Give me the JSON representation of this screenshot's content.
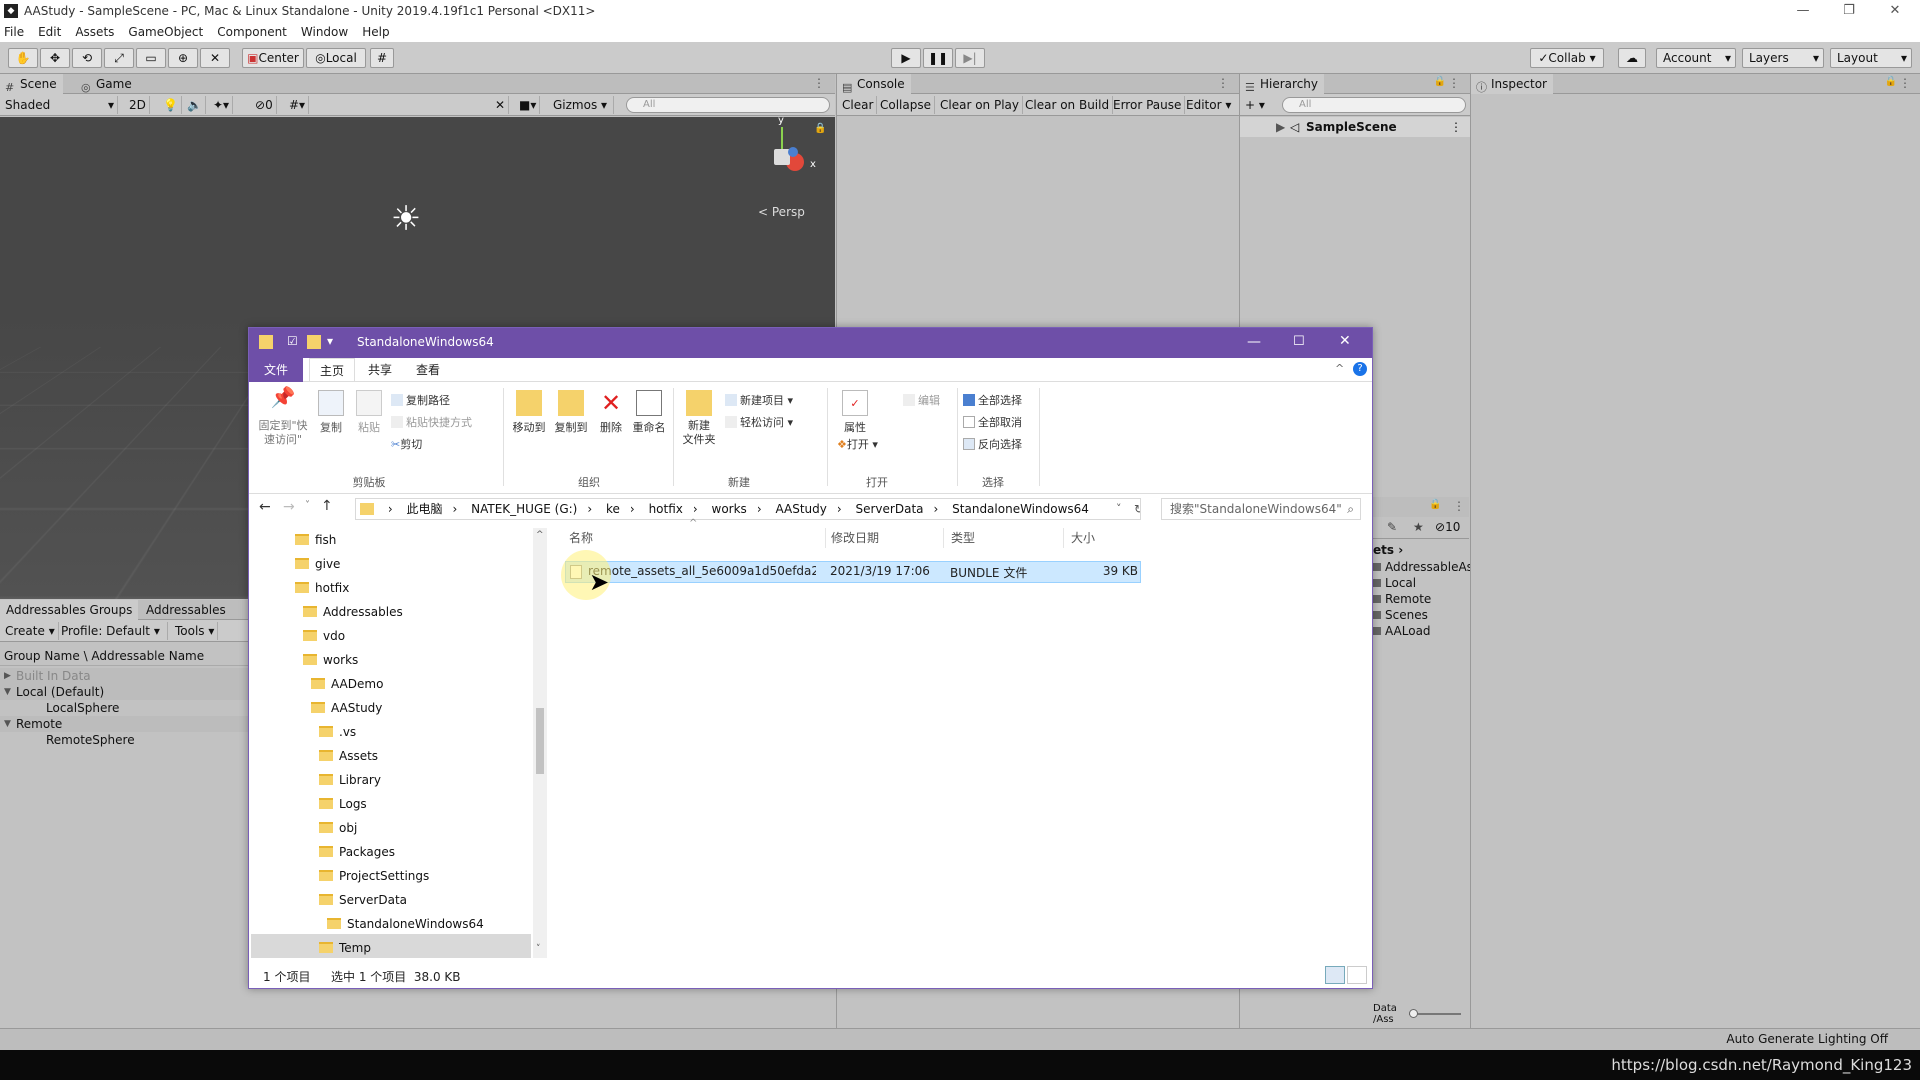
{
  "window": {
    "title": "AAStudy - SampleScene - PC, Mac & Linux Standalone - Unity 2019.4.19f1c1 Personal <DX11>"
  },
  "menu": [
    "File",
    "Edit",
    "Assets",
    "GameObject",
    "Component",
    "Window",
    "Help"
  ],
  "toolbar": {
    "center": "Center",
    "local": "Local",
    "collab": "Collab",
    "account": "Account",
    "layers": "Layers",
    "layout": "Layout"
  },
  "scene": {
    "tab_scene": "Scene",
    "tab_game": "Game",
    "shaded": "Shaded",
    "mode_2d": "2D",
    "hidden_count": "0",
    "gizmos": "Gizmos",
    "search_placeholder": "All",
    "persp": "Persp",
    "axis_y": "y",
    "axis_x": "x"
  },
  "console": {
    "tab": "Console",
    "buttons": [
      "Clear",
      "Collapse",
      "Clear on Play",
      "Clear on Build",
      "Error Pause",
      "Editor"
    ]
  },
  "hierarchy": {
    "tab": "Hierarchy",
    "search_placeholder": "All",
    "scene_name": "SampleScene"
  },
  "inspector": {
    "tab": "Inspector"
  },
  "addressables": {
    "tab_groups": "Addressables Groups",
    "tab_profiler": "Addressables Prof",
    "create": "Create",
    "profile": "Profile: Default",
    "tools": "Tools",
    "header": "Group Name \\ Addressable Name",
    "rows": [
      {
        "label": "Built In Data",
        "indent": 0,
        "arrow": "▶"
      },
      {
        "label": "Local (Default)",
        "indent": 0,
        "arrow": "▼"
      },
      {
        "label": "LocalSphere",
        "indent": 1,
        "arrow": ""
      },
      {
        "label": "Remote",
        "indent": 0,
        "arrow": "▼"
      },
      {
        "label": "RemoteSphere",
        "indent": 1,
        "arrow": ""
      }
    ]
  },
  "project": {
    "crumb": "ets",
    "count": "10",
    "items": [
      "AddressableAs",
      "Local",
      "Remote",
      "Scenes",
      "AALoad"
    ],
    "slider_label": "Data\n/Ass"
  },
  "explorer": {
    "title": "StandaloneWindows64",
    "tabs": [
      "文件",
      "主页",
      "共享",
      "查看"
    ],
    "ribbon": {
      "pin": "固定到\"快\n速访问\"",
      "copy": "复制",
      "paste": "粘贴",
      "copy_path": "复制路径",
      "paste_shortcut": "粘贴快捷方式",
      "cut": "剪切",
      "move_to": "移动到",
      "copy_to": "复制到",
      "delete": "删除",
      "rename": "重命名",
      "new_folder": "新建\n文件夹",
      "new_item": "新建项目",
      "easy_access": "轻松访问",
      "properties": "属性",
      "open": "打开",
      "edit": "编辑",
      "select_all": "全部选择",
      "select_none": "全部取消",
      "invert": "反向选择",
      "groups": [
        "剪贴板",
        "组织",
        "新建",
        "打开",
        "选择"
      ]
    },
    "path": [
      "此电脑",
      "NATEK_HUGE (G:)",
      "ke",
      "hotfix",
      "works",
      "AAStudy",
      "ServerData",
      "StandaloneWindows64"
    ],
    "search_placeholder": "搜索\"StandaloneWindows64\"",
    "tree": [
      {
        "label": "fish",
        "indent": 0
      },
      {
        "label": "give",
        "indent": 0
      },
      {
        "label": "hotfix",
        "indent": 0
      },
      {
        "label": "Addressables",
        "indent": 1
      },
      {
        "label": "vdo",
        "indent": 1
      },
      {
        "label": "works",
        "indent": 1
      },
      {
        "label": "AADemo",
        "indent": 2
      },
      {
        "label": "AAStudy",
        "indent": 2
      },
      {
        "label": ".vs",
        "indent": 3
      },
      {
        "label": "Assets",
        "indent": 3
      },
      {
        "label": "Library",
        "indent": 3
      },
      {
        "label": "Logs",
        "indent": 3
      },
      {
        "label": "obj",
        "indent": 3
      },
      {
        "label": "Packages",
        "indent": 3
      },
      {
        "label": "ProjectSettings",
        "indent": 3
      },
      {
        "label": "ServerData",
        "indent": 3
      },
      {
        "label": "StandaloneWindows64",
        "indent": 4,
        "selected": true
      },
      {
        "label": "Temp",
        "indent": 3
      }
    ],
    "columns": [
      "名称",
      "修改日期",
      "类型",
      "大小"
    ],
    "file": {
      "name": "remote_assets_all_5e6009a1d50efda2...",
      "date": "2021/3/19 17:06",
      "type": "BUNDLE 文件",
      "size": "39 KB"
    },
    "status": {
      "count": "1 个项目",
      "selected": "选中 1 个项目  38.0 KB"
    }
  },
  "statusbar": {
    "lighting": "Auto Generate Lighting Off"
  },
  "watermark": "https://blog.csdn.net/Raymond_King123"
}
